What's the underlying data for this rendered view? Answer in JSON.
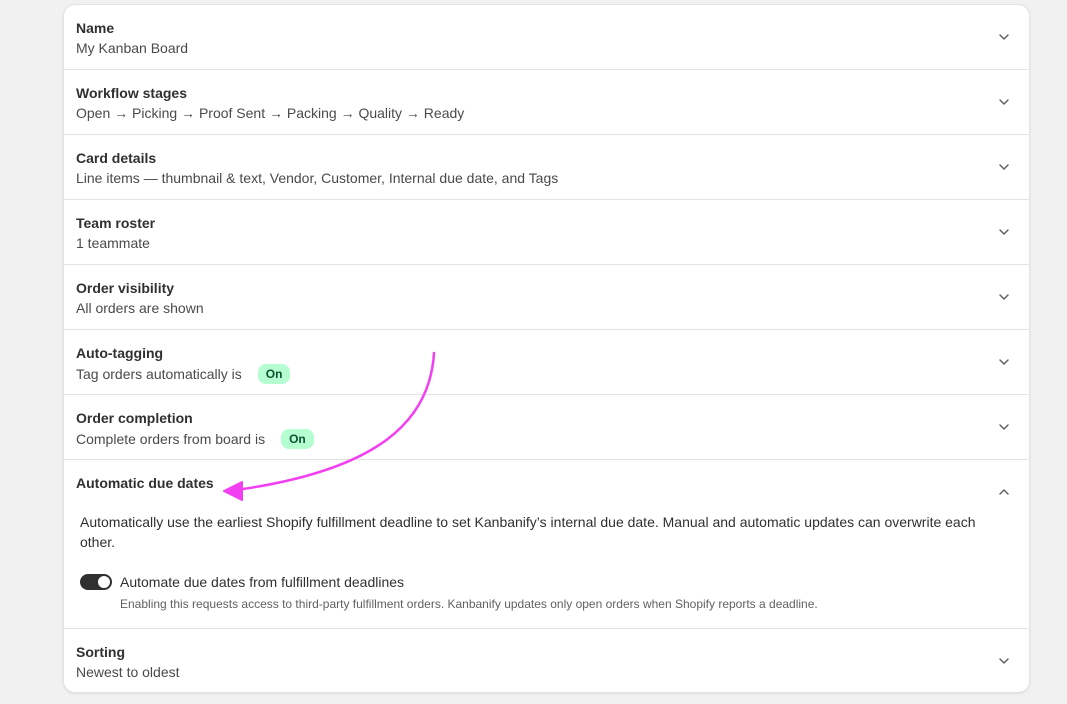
{
  "sections": [
    {
      "title": "Name",
      "summary": "My Kanban Board"
    },
    {
      "title": "Workflow stages",
      "summary": "Open → Picking → Proof Sent → Packing → Quality → Ready"
    },
    {
      "title": "Card details",
      "summary": "Line items — thumbnail & text, Vendor, Customer, Internal due date, and Tags"
    },
    {
      "title": "Team roster",
      "summary": "1 teammate"
    },
    {
      "title": "Order visibility",
      "summary": "All orders are shown"
    },
    {
      "title": "Auto-tagging",
      "summary": "Tag orders automatically is",
      "badge": "On"
    },
    {
      "title": "Order completion",
      "summary": "Complete orders from board is",
      "badge": "On"
    },
    {
      "title": "Automatic due dates",
      "description": "Automatically use the earliest Shopify fulfillment deadline to set Kanbanify’s internal due date. Manual and automatic updates can overwrite each other.",
      "toggle_label": "Automate due dates from fulfillment deadlines",
      "toggle_help": "Enabling this requests access to third-party fulfillment orders. Kanbanify updates only open orders when Shopify reports a deadline.",
      "toggle_on": true
    },
    {
      "title": "Sorting",
      "summary": "Newest to oldest"
    }
  ],
  "icons": {
    "collapsed": "chevron-down-icon",
    "expanded": "chevron-up-icon"
  },
  "colors": {
    "badge_bg": "#b4fed2",
    "badge_text": "#0c5132",
    "annotation_arrow": "#f23ff2",
    "toggle_on": "#303030"
  }
}
